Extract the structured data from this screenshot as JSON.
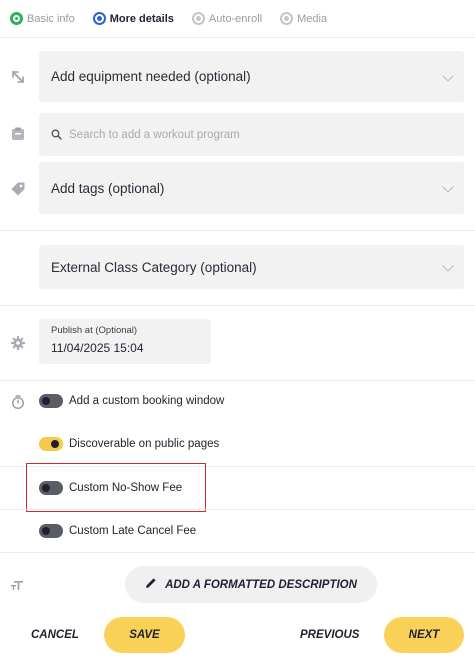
{
  "stepper": {
    "steps": [
      {
        "label": "Basic info",
        "state": "done"
      },
      {
        "label": "More details",
        "state": "current"
      },
      {
        "label": "Auto-enroll",
        "state": "pending"
      },
      {
        "label": "Media",
        "state": "pending"
      }
    ]
  },
  "equipment": {
    "label": "Add equipment needed (optional)",
    "icon": "expand-arrows-icon"
  },
  "workout": {
    "placeholder": "Search to add a workout program",
    "value": "",
    "icon": "clipboard-icon"
  },
  "tags": {
    "label": "Add tags (optional)",
    "icon": "tag-icon"
  },
  "category": {
    "label": "External Class Category (optional)"
  },
  "publish": {
    "label": "Publish at (Optional)",
    "value": "11/04/2025 15:04",
    "icon": "gear-icon"
  },
  "toggles": [
    {
      "label": "Add a custom booking window",
      "on": false,
      "icon": "stopwatch-icon"
    },
    {
      "label": "Discoverable on public pages",
      "on": true
    },
    {
      "label": "Custom No-Show Fee",
      "on": false
    },
    {
      "label": "Custom Late Cancel Fee",
      "on": false
    }
  ],
  "description": {
    "label": "ADD A FORMATTED DESCRIPTION",
    "icon": "text-size-icon"
  },
  "footer": {
    "cancel": "CANCEL",
    "save": "SAVE",
    "previous": "PREVIOUS",
    "next": "NEXT"
  },
  "colors": {
    "accent": "#f9d158",
    "toggle_on": "#f7c948",
    "highlight": "#d32a2a",
    "step_done": "#2fb15b",
    "step_current": "#2c62d6"
  }
}
